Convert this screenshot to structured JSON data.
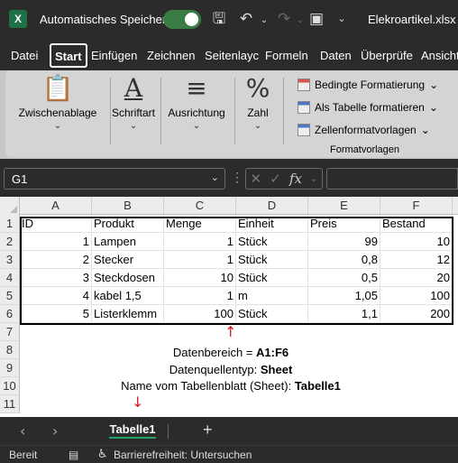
{
  "titlebar": {
    "app_icon": "excel-logo",
    "app_icon_letter": "X",
    "autosave_label": "Automatisches Speichern",
    "autosave_on": true,
    "icons": [
      "save-icon",
      "undo-icon",
      "redo-icon",
      "camera-icon"
    ],
    "filename": "Elekroartikel.xlsx"
  },
  "menu": {
    "tabs": [
      "Datei",
      "Start",
      "Einfügen",
      "Zeichnen",
      "Seitenlayc",
      "Formeln",
      "Daten",
      "Überprüfe",
      "Ansicht"
    ],
    "active": "Start"
  },
  "ribbon": {
    "clipboard": "Zwischenablage",
    "font": "Schriftart",
    "alignment": "Ausrichtung",
    "number": "Zahl",
    "styles": {
      "conditional": "Bedingte Formatierung",
      "as_table": "Als Tabelle formatieren",
      "cell_styles": "Zellenformatvorlagen",
      "group_label": "Formatvorlagen"
    }
  },
  "formula_bar": {
    "name_box": "G1",
    "fx": "fx",
    "value": ""
  },
  "grid": {
    "columns": [
      "A",
      "B",
      "C",
      "D",
      "E",
      "F"
    ],
    "rows": [
      "1",
      "2",
      "3",
      "4",
      "5",
      "6",
      "7",
      "8",
      "9",
      "10",
      "11"
    ],
    "header": [
      "ID",
      "Produkt",
      "Menge",
      "Einheit",
      "Preis",
      "Bestand"
    ],
    "data": [
      [
        "1",
        "Lampen",
        "1",
        "Stück",
        "99",
        "10"
      ],
      [
        "2",
        "Stecker",
        "1",
        "Stück",
        "0,8",
        "12"
      ],
      [
        "3",
        "Steckdosen",
        "10",
        "Stück",
        "0,5",
        "20"
      ],
      [
        "4",
        "kabel 1,5",
        "1",
        "m",
        "1,05",
        "100"
      ],
      [
        "5",
        "Listerklemm",
        "100",
        "Stück",
        "1,1",
        "200"
      ]
    ]
  },
  "annotation": {
    "line1_prefix": "Datenbereich = ",
    "line1_value": "A1:F6",
    "line2_prefix": "Datenquellentyp: ",
    "line2_value": "Sheet",
    "line3_prefix": "Name vom Tabellenblatt (Sheet): ",
    "line3_value": "Tabelle1",
    "arrow_up": "↑",
    "arrow_down": "↓",
    "arrow_color": "#d21f1f"
  },
  "sheets": {
    "tabs": [
      "Tabelle1"
    ],
    "active": "Tabelle1",
    "add": "+"
  },
  "status": {
    "ready": "Bereit",
    "accessibility": "Barrierefreiheit: Untersuchen"
  }
}
